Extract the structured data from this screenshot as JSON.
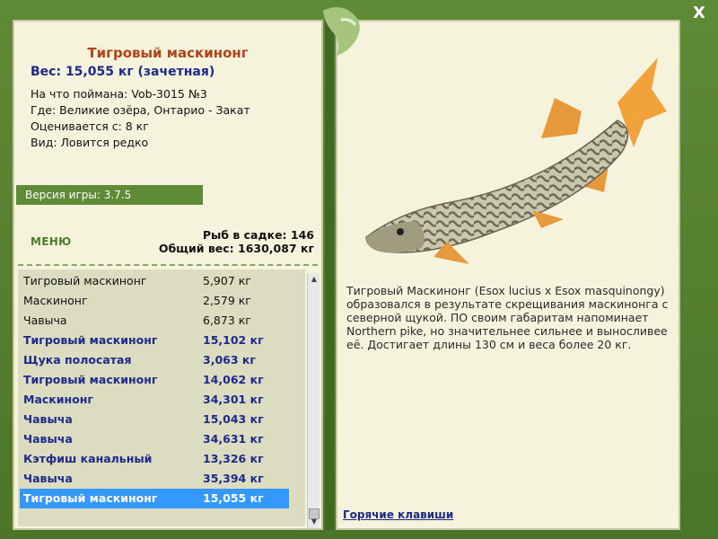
{
  "close_label": "X",
  "fish": {
    "title": "Тигровый маскинонг",
    "weight": "Вес: 15,055 кг (зачетная)",
    "caught_on": "На что поймана: Vob-3015 №3",
    "location": "Где: Великие озёра, Онтарио - Закат",
    "rated_from": "Оценивается с: 8 кг",
    "kind": "Вид: Ловится редко",
    "description": "Тигровый Маскинонг (Esox lucius x Esox masquinongy) образовался в результате скрещивания маскинонга с северной щукой. ПО своим габаритам напоминает Northern pike, но значительнее сильнее и выносливее её. Достигает длины 130 см и веса более 20 кг."
  },
  "version_label": "Версия игры: 3.7.5",
  "menu_label": "МЕНЮ",
  "stats": {
    "fish_count": "Рыб в садке: 146",
    "total_weight": "Общий вес: 1630,087 кг"
  },
  "catch_list": [
    {
      "name": "Тигровый маскинонг",
      "weight": "5,907 кг",
      "style": "normal"
    },
    {
      "name": "Маскинонг",
      "weight": "2,579 кг",
      "style": "normal"
    },
    {
      "name": "Чавыча",
      "weight": "6,873 кг",
      "style": "normal"
    },
    {
      "name": "Тигровый маскинонг",
      "weight": "15,102 кг",
      "style": "record"
    },
    {
      "name": "Щука полосатая",
      "weight": "3,063 кг",
      "style": "record"
    },
    {
      "name": "Тигровый маскинонг",
      "weight": "14,062 кг",
      "style": "record"
    },
    {
      "name": "Маскинонг",
      "weight": "34,301 кг",
      "style": "record"
    },
    {
      "name": "Чавыча",
      "weight": "15,043 кг",
      "style": "record"
    },
    {
      "name": "Чавыча",
      "weight": "34,631 кг",
      "style": "record"
    },
    {
      "name": "Кэтфиш канальный",
      "weight": "13,326 кг",
      "style": "record"
    },
    {
      "name": "Чавыча",
      "weight": "35,394 кг",
      "style": "record"
    },
    {
      "name": "Тигровый маскинонг",
      "weight": "15,055 кг",
      "style": "selected"
    }
  ],
  "hotkeys_label": "Горячие клавиши"
}
